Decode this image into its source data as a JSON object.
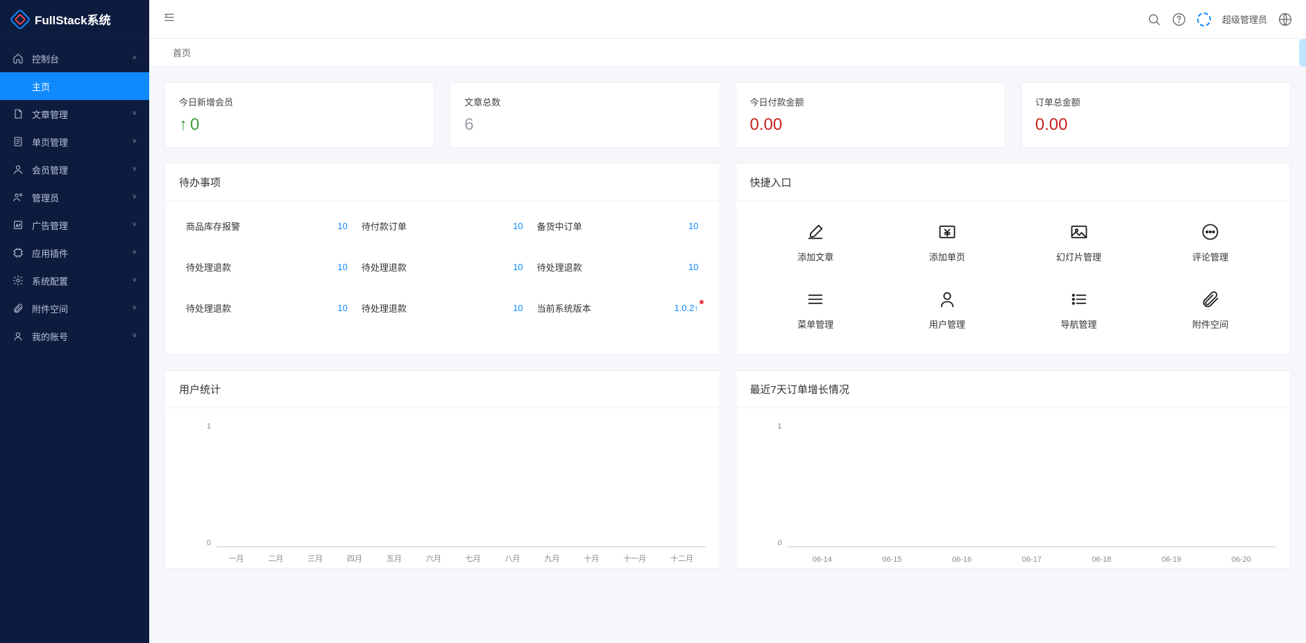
{
  "app": {
    "title": "FullStack系统"
  },
  "sidebar": {
    "items": [
      {
        "label": "控制台",
        "icon": "home",
        "expanded": true,
        "children": [
          {
            "label": "主页",
            "active": true
          }
        ]
      },
      {
        "label": "文章管理",
        "icon": "doc"
      },
      {
        "label": "单页管理",
        "icon": "page"
      },
      {
        "label": "会员管理",
        "icon": "user"
      },
      {
        "label": "管理员",
        "icon": "admin"
      },
      {
        "label": "广告管理",
        "icon": "ad"
      },
      {
        "label": "应用插件",
        "icon": "plugin"
      },
      {
        "label": "系统配置",
        "icon": "gear"
      },
      {
        "label": "附件空间",
        "icon": "attach"
      },
      {
        "label": "我的账号",
        "icon": "me"
      }
    ]
  },
  "topbar": {
    "username": "超级管理员"
  },
  "tabs": [
    {
      "label": "首页"
    }
  ],
  "stats": [
    {
      "title": "今日新增会员",
      "value": "0",
      "style": "green",
      "prefix": "↑"
    },
    {
      "title": "文章总数",
      "value": "6",
      "style": "gray"
    },
    {
      "title": "今日付款金额",
      "value": "0.00",
      "style": "red"
    },
    {
      "title": "订单总金额",
      "value": "0.00",
      "style": "red"
    }
  ],
  "todo": {
    "title": "待办事项",
    "items": [
      {
        "label": "商品库存报警",
        "value": "10"
      },
      {
        "label": "待付款订单",
        "value": "10"
      },
      {
        "label": "备货中订单",
        "value": "10"
      },
      {
        "label": "待处理退款",
        "value": "10"
      },
      {
        "label": "待处理退款",
        "value": "10"
      },
      {
        "label": "待处理退款",
        "value": "10"
      },
      {
        "label": "待处理退款",
        "value": "10"
      },
      {
        "label": "待处理退款",
        "value": "10"
      },
      {
        "label": "当前系统版本",
        "value": "1.0.2",
        "version": true
      }
    ]
  },
  "quick": {
    "title": "快捷入口",
    "items": [
      {
        "label": "添加文章",
        "icon": "edit"
      },
      {
        "label": "添加单页",
        "icon": "rmb"
      },
      {
        "label": "幻灯片管理",
        "icon": "image"
      },
      {
        "label": "评论管理",
        "icon": "chat"
      },
      {
        "label": "菜单管理",
        "icon": "menu"
      },
      {
        "label": "用户管理",
        "icon": "user2"
      },
      {
        "label": "导航管理",
        "icon": "list"
      },
      {
        "label": "附件空间",
        "icon": "clip"
      }
    ]
  },
  "charts": {
    "user": {
      "title": "用户统计"
    },
    "order": {
      "title": "最近7天订单增长情况"
    }
  },
  "chart_data": [
    {
      "type": "line",
      "title": "用户统计",
      "categories": [
        "一月",
        "二月",
        "三月",
        "四月",
        "五月",
        "六月",
        "七月",
        "八月",
        "九月",
        "十月",
        "十一月",
        "十二月"
      ],
      "values": [
        0,
        0,
        0,
        0,
        0,
        0,
        0,
        0,
        0,
        0,
        0,
        0
      ],
      "ylim": [
        0,
        1
      ],
      "yticks": [
        0,
        1
      ]
    },
    {
      "type": "line",
      "title": "最近7天订单增长情况",
      "categories": [
        "06-14",
        "06-15",
        "06-16",
        "06-17",
        "06-18",
        "06-19",
        "06-20"
      ],
      "values": [
        0,
        0,
        0,
        0,
        0,
        0,
        0
      ],
      "ylim": [
        0,
        1
      ],
      "yticks": [
        0,
        1
      ]
    }
  ]
}
